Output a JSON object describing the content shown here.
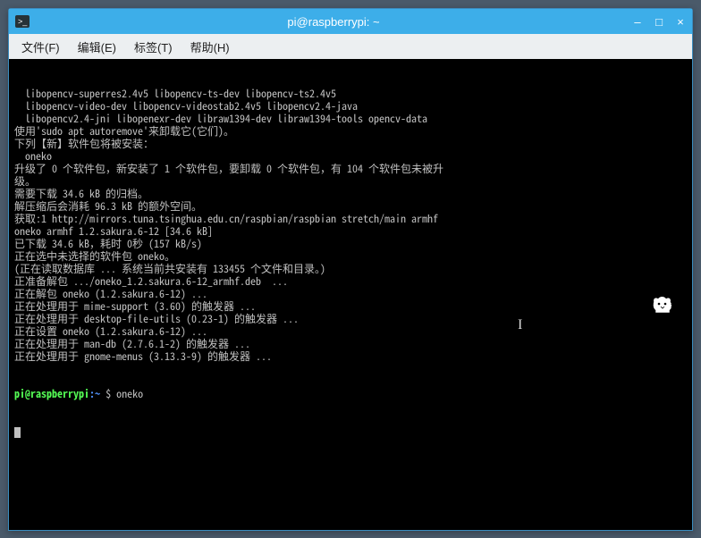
{
  "window": {
    "title": "pi@raspberrypi: ~",
    "controls": {
      "min": "–",
      "max": "□",
      "close": "×"
    }
  },
  "menubar": {
    "file": "文件(F)",
    "edit": "编辑(E)",
    "tabs": "标签(T)",
    "help": "帮助(H)"
  },
  "terminal": {
    "lines": [
      "  libopencv-superres2.4v5 libopencv-ts-dev libopencv-ts2.4v5",
      "  libopencv-video-dev libopencv-videostab2.4v5 libopencv2.4-java",
      "  libopencv2.4-jni libopenexr-dev libraw1394-dev libraw1394-tools opencv-data",
      "使用'sudo apt autoremove'来卸载它(它们)。",
      "下列【新】软件包将被安装：",
      "  oneko",
      "升级了 0 个软件包，新安装了 1 个软件包，要卸载 0 个软件包，有 104 个软件包未被升",
      "级。",
      "需要下载 34.6 kB 的归档。",
      "解压缩后会消耗 96.3 kB 的额外空间。",
      "获取:1 http://mirrors.tuna.tsinghua.edu.cn/raspbian/raspbian stretch/main armhf",
      "oneko armhf 1.2.sakura.6-12 [34.6 kB]",
      "已下载 34.6 kB，耗时 0秒 (157 kB/s)",
      "正在选中未选择的软件包 oneko。",
      "(正在读取数据库 ... 系统当前共安装有 133455 个文件和目录。)",
      "正准备解包 .../oneko_1.2.sakura.6-12_armhf.deb  ...",
      "正在解包 oneko (1.2.sakura.6-12) ...",
      "正在处理用于 mime-support (3.60) 的触发器 ...",
      "正在处理用于 desktop-file-utils (0.23-1) 的触发器 ...",
      "正在设置 oneko (1.2.sakura.6-12) ...",
      "正在处理用于 man-db (2.7.6.1-2) 的触发器 ...",
      "正在处理用于 gnome-menus (3.13.3-9) 的触发器 ..."
    ],
    "prompt": {
      "user": "pi",
      "at": "@",
      "host": "raspberrypi",
      "colon": ":",
      "path": "~",
      "dollar": " $ ",
      "command": "oneko"
    }
  },
  "sprites": {
    "oneko_name": "oneko-cat-sprite"
  }
}
